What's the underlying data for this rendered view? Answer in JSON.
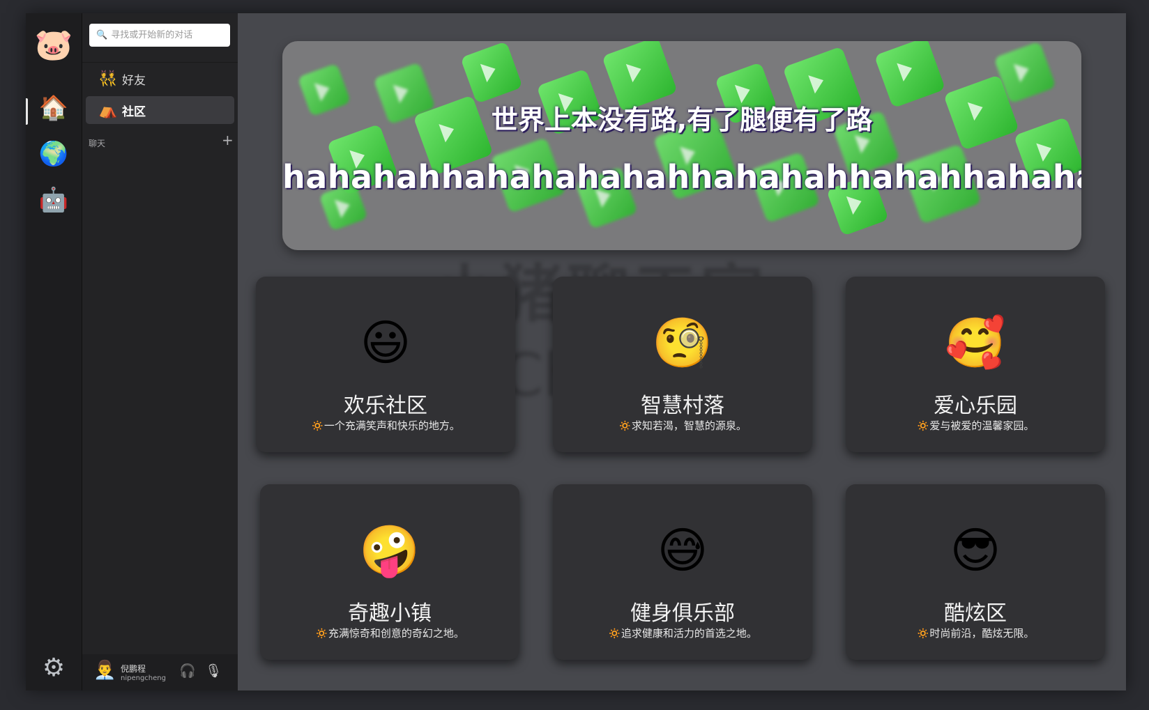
{
  "app": {
    "logo_icon": "pig-face-icon",
    "logo_glyph": "🐷"
  },
  "rail": {
    "items": [
      {
        "name": "home",
        "glyph": "🏠",
        "active": true
      },
      {
        "name": "globe",
        "glyph": "🌍",
        "active": false
      },
      {
        "name": "robot",
        "glyph": "🤖",
        "active": false
      }
    ],
    "settings_glyph": "⚙"
  },
  "sidebar": {
    "search": {
      "placeholder": "寻找或开始新的对话",
      "icon_glyph": "🔍"
    },
    "nav": [
      {
        "label": "好友",
        "glyph": "👯",
        "active": false
      },
      {
        "label": "社区",
        "glyph": "⛺",
        "active": true
      }
    ],
    "section_label": "聊天",
    "add_glyph": "+",
    "user": {
      "name": "倪鹏程",
      "id": "nipengcheng",
      "avatar_glyph": "👨‍💼",
      "headphones_glyph": "🎧",
      "mic_glyph": "🎙"
    }
  },
  "banner": {
    "title": "世界上本没有路,有了腿便有了路",
    "subtitle": "hahahahhahahahahahhahahahhahahhahahahah",
    "background_color": "#7a7a7c",
    "cube_color": "#3fcc3f"
  },
  "watermark": {
    "line1": "小猪聊天室",
    "line2": "PigChat.com"
  },
  "communities": [
    {
      "emoji": "😃",
      "title": "欢乐社区",
      "sun": "🔅",
      "desc": "一个充满笑声和快乐的地方。"
    },
    {
      "emoji": "🧐",
      "title": "智慧村落",
      "sun": "🔅",
      "desc": "求知若渴，智慧的源泉。"
    },
    {
      "emoji": "🥰",
      "title": "爱心乐园",
      "sun": "🔅",
      "desc": "爱与被爱的温馨家园。"
    },
    {
      "emoji": "🤪",
      "title": "奇趣小镇",
      "sun": "🔅",
      "desc": "充满惊奇和创意的奇幻之地。"
    },
    {
      "emoji": "😅",
      "title": "健身俱乐部",
      "sun": "🔅",
      "desc": "追求健康和活力的首选之地。"
    },
    {
      "emoji": "😎",
      "title": "酷炫区",
      "sun": "🔅",
      "desc": "时尚前沿，酷炫无限。"
    }
  ]
}
